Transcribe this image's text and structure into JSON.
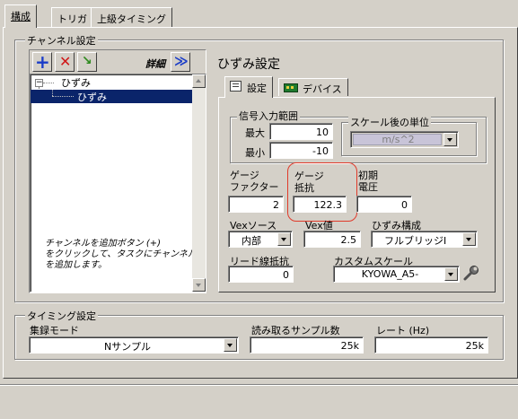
{
  "tabs": [
    {
      "label": "構成",
      "active": true
    },
    {
      "label": "トリガ",
      "active": false
    },
    {
      "label": "上級タイミング",
      "active": false
    }
  ],
  "channel_settings": {
    "group_label": "チャンネル設定",
    "toolbar": {
      "add_icon": "plus-icon",
      "remove_icon": "red-x-icon",
      "rename_icon": "green-check-icon",
      "details_label": "詳細",
      "expand_label": "≫"
    },
    "tree": {
      "parent_label": "ひずみ",
      "child_label": "ひずみ"
    },
    "help_text": "チャンネルを追加ボタン (+)\nをクリックして、タスクにチャンネル\nを追加します。"
  },
  "strain": {
    "title": "ひずみ設定",
    "subtabs": [
      {
        "label": "設定",
        "icon": "settings-icon",
        "active": true
      },
      {
        "label": "デバイス",
        "icon": "device-icon",
        "active": false
      }
    ],
    "signal_range": {
      "group_label": "信号入力範囲",
      "max_label": "最大",
      "max_value": "10",
      "min_label": "最小",
      "min_value": "-10"
    },
    "scaled_units": {
      "group_label": "スケール後の単位",
      "value": "m/s^2"
    },
    "gauge_factor": {
      "label_line1": "ゲージ",
      "label_line2": "ファクター",
      "value": "2"
    },
    "gauge_resistance": {
      "label_line1": "ゲージ",
      "label_line2": "抵抗",
      "value": "122.3"
    },
    "initial_voltage": {
      "label_line1": "初期",
      "label_line2": "電圧",
      "value": "0"
    },
    "vex_source": {
      "label": "Vexソース",
      "value": "内部"
    },
    "vex_value": {
      "label": "Vex値",
      "value": "2.5"
    },
    "strain_config": {
      "label": "ひずみ構成",
      "value": "フルブリッジI"
    },
    "lead_resistance": {
      "label": "リード線抵抗",
      "value": "0"
    },
    "custom_scale": {
      "label": "カスタムスケール",
      "value": "KYOWA_A5-",
      "icon": "wrench-icon"
    },
    "highlight_color": "#e03a2a"
  },
  "timing": {
    "group_label": "タイミング設定",
    "mode_label": "集録モード",
    "mode_value": "Nサンプル",
    "samples_label": "読み取るサンプル数",
    "samples_value": "25k",
    "rate_label": "レート (Hz)",
    "rate_value": "25k"
  },
  "colors": {
    "selection": "#0a246a",
    "add_blue": "#1a3cc8",
    "remove_red": "#d01818",
    "check_green": "#2e8a1e"
  }
}
